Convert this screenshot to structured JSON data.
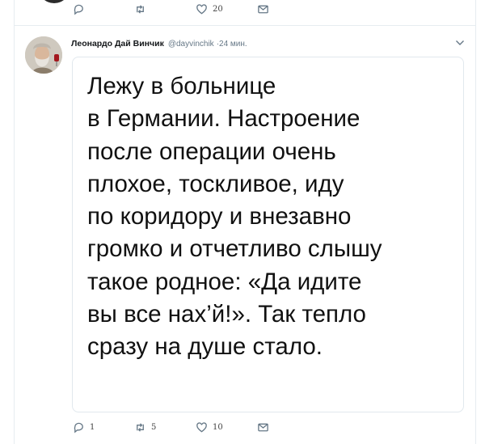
{
  "previous_tweet": {
    "actions": {
      "reply_count": "",
      "retweet_count": "",
      "like_count": "20"
    }
  },
  "tweet": {
    "author_name": "Леонардо Дай Винчик",
    "author_handle": "@dayvinchik",
    "timestamp": "·24 мин.",
    "image_text": "Лежу в больнице\nв Германии. Настроение\nпосле операции очень\nплохое, тоскливое, иду\nпо коридору и внезавно\nгромко и отчетливо слышу\nтакое родное: «Да идите\nвы все нах’й!». Так тепло\nсразу на душе стало.",
    "actions": {
      "reply_count": "1",
      "retweet_count": "5",
      "like_count": "10"
    }
  },
  "icons": {
    "reply": "reply-icon",
    "retweet": "retweet-icon",
    "like": "heart-icon",
    "message": "envelope-icon",
    "caret": "chevron-down-icon"
  },
  "colors": {
    "icon_gray": "#657786",
    "border": "#e1e8ed"
  }
}
